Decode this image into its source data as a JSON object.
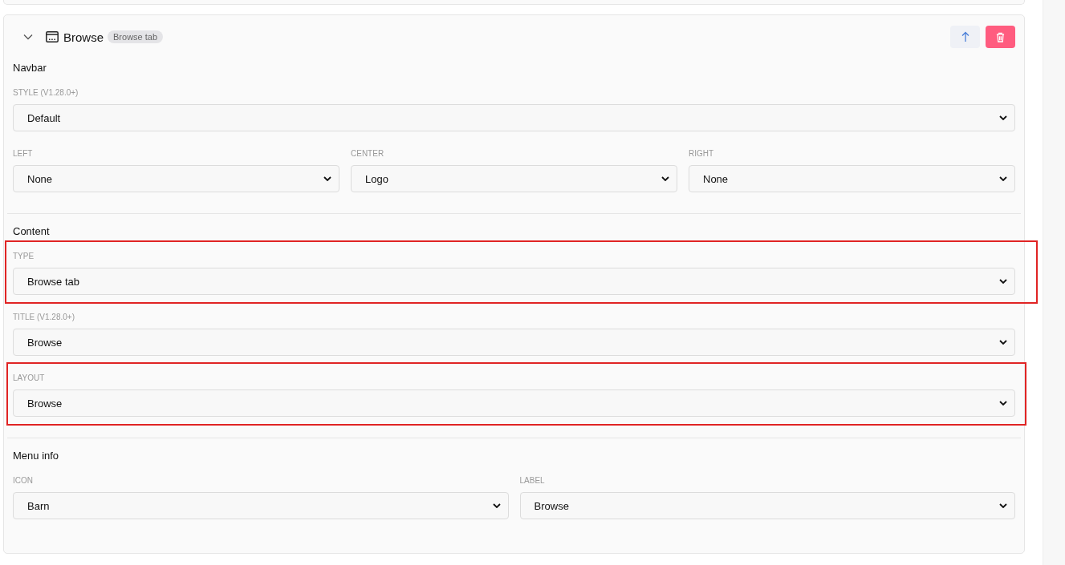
{
  "card": {
    "expanded": true,
    "title": "Browse",
    "badge": "Browse tab"
  },
  "sections": [
    {
      "title": "Navbar",
      "rows": [
        [
          {
            "label": "STYLE (V1.28.0+)",
            "value": "Default",
            "highlighted": false
          }
        ],
        [
          {
            "label": "LEFT",
            "value": "None",
            "highlighted": false
          },
          {
            "label": "CENTER",
            "value": "Logo",
            "highlighted": false
          },
          {
            "label": "RIGHT",
            "value": "None",
            "highlighted": false
          }
        ]
      ]
    },
    {
      "title": "Content",
      "rows": [
        [
          {
            "label": "TYPE",
            "value": "Browse tab",
            "highlighted": true
          }
        ],
        [
          {
            "label": "TITLE (V1.28.0+)",
            "value": "Browse",
            "highlighted": false
          }
        ],
        [
          {
            "label": "LAYOUT",
            "value": "Browse",
            "highlighted": true
          }
        ]
      ]
    },
    {
      "title": "Menu info",
      "rows": [
        [
          {
            "label": "ICON",
            "value": "Barn",
            "highlighted": false
          },
          {
            "label": "LABEL",
            "value": "Browse",
            "highlighted": false
          }
        ]
      ]
    }
  ]
}
